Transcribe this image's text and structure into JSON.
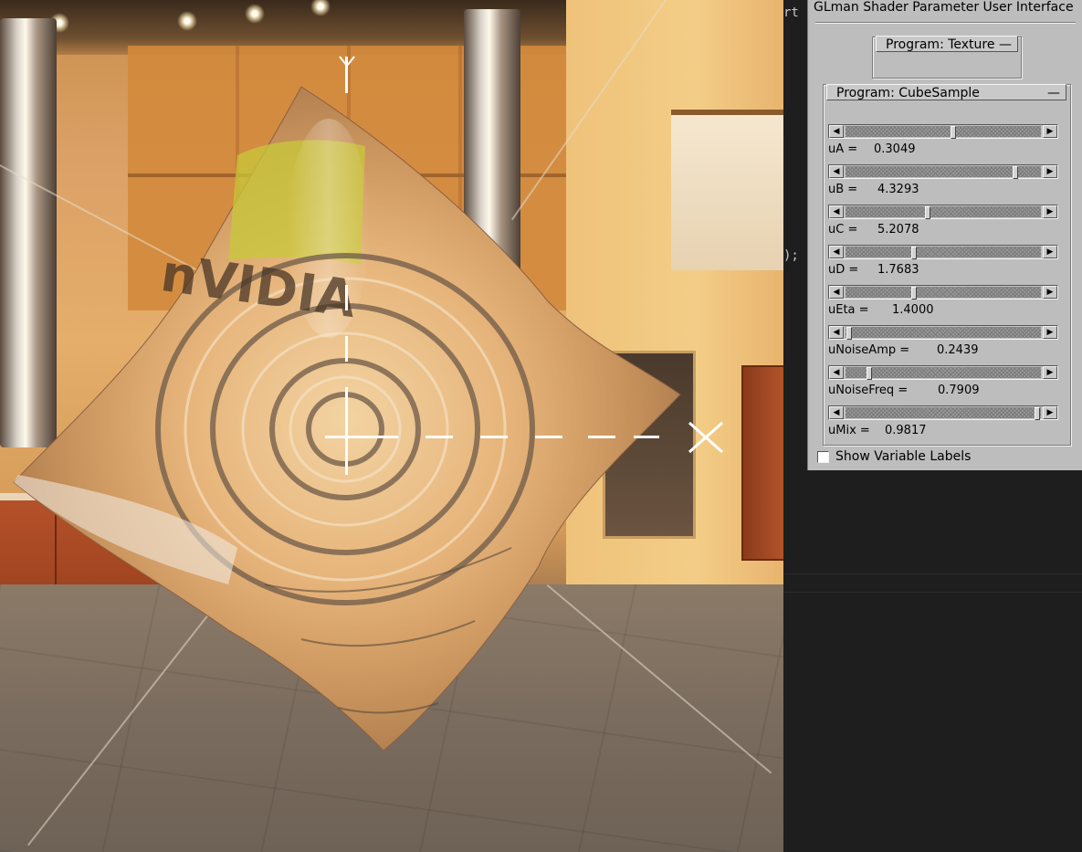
{
  "terminal": {
    "fragment_top": "rt t",
    "fragment_mid": ");"
  },
  "panel": {
    "title": "GLman Shader Parameter User Interface",
    "rollouts": [
      {
        "label": "Program: Texture",
        "toggle": "—"
      },
      {
        "label": "Program: CubeSample",
        "toggle": "—"
      }
    ],
    "params": [
      {
        "name": "uA =",
        "value": "0.3049",
        "fraction": 0.55
      },
      {
        "name": "uB =",
        "value": "4.3293",
        "fraction": 0.87
      },
      {
        "name": "uC =",
        "value": "5.2078",
        "fraction": 0.42
      },
      {
        "name": "uD =",
        "value": "1.7683",
        "fraction": 0.35
      },
      {
        "name": "uEta =",
        "value": "1.4000",
        "fraction": 0.35
      },
      {
        "name": "uNoiseAmp =",
        "value": "0.2439",
        "fraction": 0.02
      },
      {
        "name": "uNoiseFreq =",
        "value": "0.7909",
        "fraction": 0.12
      },
      {
        "name": "uMix =",
        "value": "0.9817",
        "fraction": 0.98
      }
    ],
    "show_labels": {
      "label": "Show Variable Labels",
      "checked": false
    }
  },
  "icons": {
    "arrow_left": "◀",
    "arrow_right": "▶"
  }
}
